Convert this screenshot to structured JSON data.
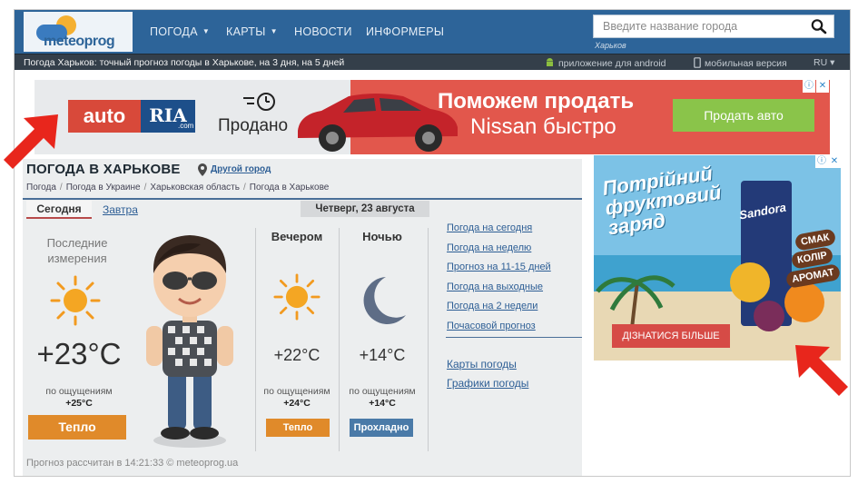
{
  "header": {
    "logo_text": "meteoprog",
    "nav": [
      {
        "label": "ПОГОДА",
        "has_caret": true
      },
      {
        "label": "КАРТЫ",
        "has_caret": true
      },
      {
        "label": "НОВОСТИ",
        "has_caret": false
      },
      {
        "label": "ИНФОРМЕРЫ",
        "has_caret": false
      }
    ],
    "search_placeholder": "Введите название города",
    "search_city": "Харьков"
  },
  "subbar": {
    "title": "Погода Харьков: точный прогноз погоды в Харькове, на 3 дня, на 5 дней",
    "android": "приложение для android",
    "mobile": "мобильная версия",
    "lang": "RU ▾"
  },
  "ad_top": {
    "logo_auto": "auto",
    "logo_ria": "RIA",
    "logo_dotcom": ".com",
    "sold": "Продано",
    "headline": "Поможем продать",
    "subline": "Nissan быстро",
    "button": "Продать авто"
  },
  "ad_side": {
    "title": "Потрійний фруктовий заряд",
    "brand": "Sandora",
    "bubbles": [
      "СМАК",
      "КОЛІР",
      "АРОМАТ"
    ],
    "button": "ДІЗНАТИСЯ БІЛЬШЕ"
  },
  "weather": {
    "title": "ПОГОДА В ХАРЬКОВЕ",
    "other_city": "Другой город",
    "breadcrumbs": [
      "Погода",
      "Погода в Украине",
      "Харьковская область",
      "Погода в Харькове"
    ],
    "tab_today": "Сегодня",
    "tab_tomorrow": "Завтра",
    "date": "Четверг, 23 августа",
    "now": {
      "label": "Последние измерения",
      "temp": "+23°C",
      "feels_label": "по ощущениям",
      "feels": "+25°C",
      "badge": "Тепло"
    },
    "evening": {
      "label": "Вечером",
      "temp": "+22°C",
      "feels_label": "по ощущениям",
      "feels": "+24°C",
      "badge": "Тепло"
    },
    "night": {
      "label": "Ночью",
      "temp": "+14°C",
      "feels_label": "по ощущениям",
      "feels": "+14°C",
      "badge": "Прохладно"
    },
    "links": [
      "Погода на сегодня",
      "Погода на неделю",
      "Прогноз на 11-15 дней",
      "Погода на выходные",
      "Погода на 2 недели",
      "Почасовой прогноз"
    ],
    "links2": [
      "Карты погоды",
      "Графики погоды"
    ],
    "footer": "Прогноз рассчитан в 14:21:33 © meteoprog.ua"
  },
  "colors": {
    "header_bg": "#2d6499",
    "warm_badge": "#e08a2a",
    "cool_badge": "#4a7aa8",
    "arrow": "#e8261c"
  }
}
